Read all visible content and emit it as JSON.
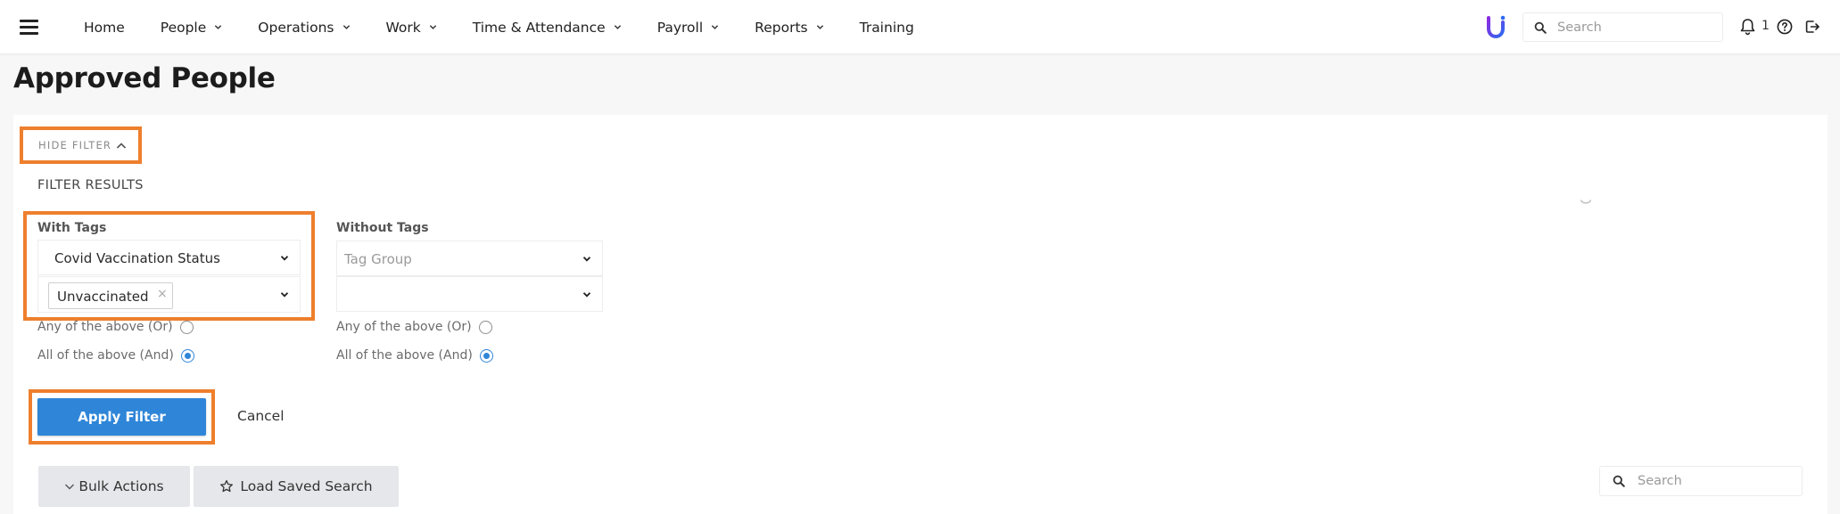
{
  "nav": {
    "items": [
      {
        "label": "Home",
        "dropdown": false
      },
      {
        "label": "People",
        "dropdown": true
      },
      {
        "label": "Operations",
        "dropdown": true
      },
      {
        "label": "Work",
        "dropdown": true
      },
      {
        "label": "Time & Attendance",
        "dropdown": true
      },
      {
        "label": "Payroll",
        "dropdown": true
      },
      {
        "label": "Reports",
        "dropdown": true
      },
      {
        "label": "Training",
        "dropdown": false
      }
    ],
    "search_placeholder": "Search",
    "notification_count": "1",
    "logo_icon": "u-logo-icon",
    "colors": {
      "logo_start": "#7b2ff7",
      "logo_end": "#2d6bf0"
    }
  },
  "page": {
    "title": "Approved People"
  },
  "filter": {
    "hide_filter_label": "HIDE FILTER",
    "results_label": "FILTER RESULTS",
    "with_tags": {
      "label": "With Tags",
      "group_value": "Covid Vaccination Status",
      "selected_tags": [
        "Unvaccinated"
      ],
      "option_or": "Any of the above (Or)",
      "option_and": "All of the above (And)",
      "selected_option": "and"
    },
    "without_tags": {
      "label": "Without Tags",
      "group_placeholder": "Tag Group",
      "tag_value": "",
      "option_or": "Any of the above (Or)",
      "option_and": "All of the above (And)",
      "selected_option": "and"
    },
    "apply_label": "Apply Filter",
    "cancel_label": "Cancel"
  },
  "toolbar": {
    "bulk_actions_label": "Bulk Actions",
    "load_saved_search_label": "Load Saved Search",
    "search_placeholder": "Search"
  },
  "colors": {
    "accent": "#2f86d8",
    "highlight": "#ee7f2d"
  }
}
